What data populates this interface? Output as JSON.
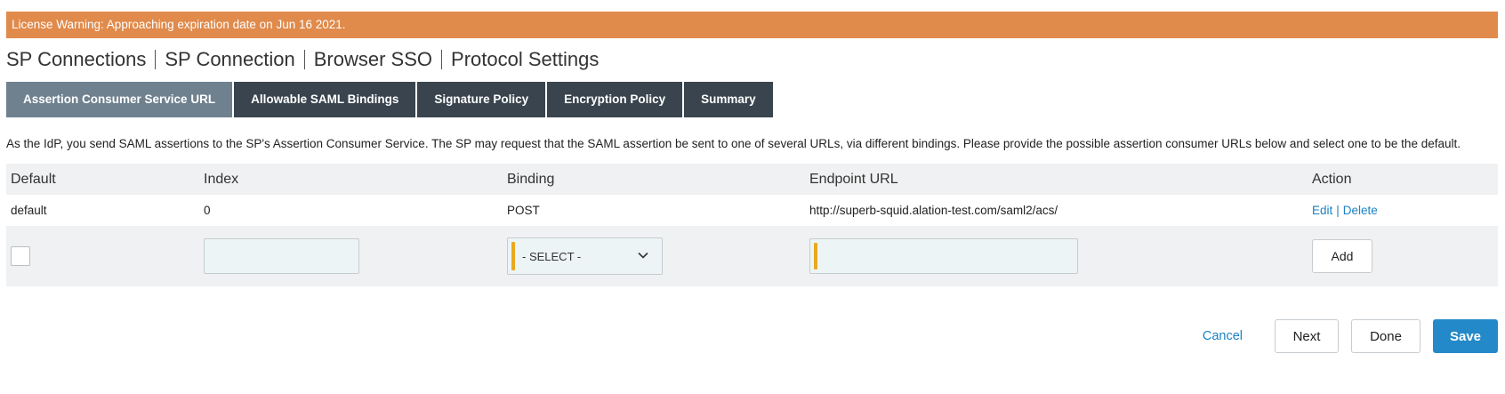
{
  "license_warning": "License Warning: Approaching expiration date on Jun 16 2021.",
  "breadcrumb": [
    "SP Connections",
    "SP Connection",
    "Browser SSO",
    "Protocol Settings"
  ],
  "tabs": [
    {
      "label": "Assertion Consumer Service URL",
      "active": true
    },
    {
      "label": "Allowable SAML Bindings",
      "active": false
    },
    {
      "label": "Signature Policy",
      "active": false
    },
    {
      "label": "Encryption Policy",
      "active": false
    },
    {
      "label": "Summary",
      "active": false
    }
  ],
  "description": "As the IdP, you send SAML assertions to the SP's Assertion Consumer Service. The SP may request that the SAML assertion be sent to one of several URLs, via different bindings. Please provide the possible assertion consumer URLs below and select one to be the default.",
  "table": {
    "columns": [
      "Default",
      "Index",
      "Binding",
      "Endpoint URL",
      "Action"
    ],
    "rows": [
      {
        "default": "default",
        "index": "0",
        "binding": "POST",
        "endpoint_url": "http://superb-squid.alation-test.com/saml2/acs/",
        "actions": [
          "Edit",
          "Delete"
        ]
      }
    ],
    "add_row": {
      "default_checked": false,
      "index_value": "",
      "binding_selected": "- SELECT -",
      "endpoint_value": "",
      "add_label": "Add"
    }
  },
  "footer": {
    "cancel": "Cancel",
    "next": "Next",
    "done": "Done",
    "save": "Save"
  },
  "colors": {
    "warning": "#e08a4b",
    "tab_active": "#6f818f",
    "tab_inactive": "#39444e",
    "link": "#1b82c4",
    "primary": "#2389c9",
    "required_marker": "#e9a91f"
  }
}
